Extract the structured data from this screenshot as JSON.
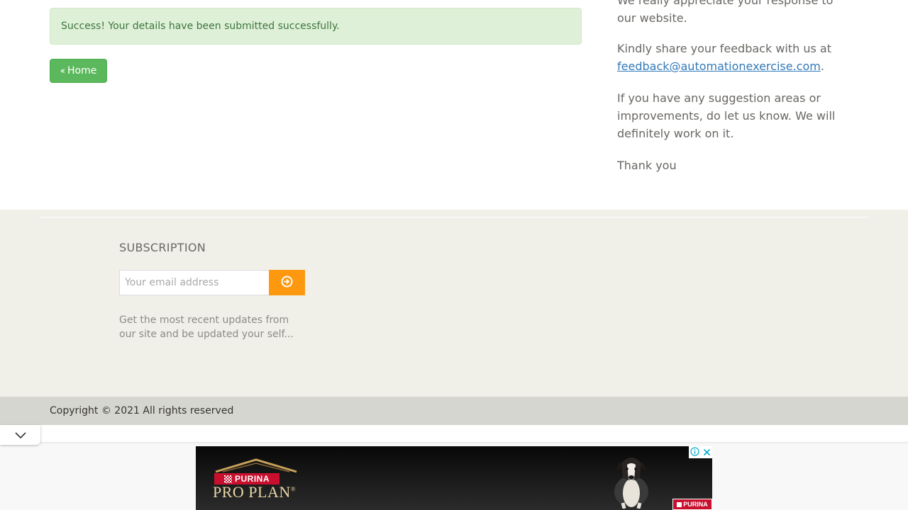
{
  "alert": {
    "message": "Success! Your details have been submitted successfully."
  },
  "home_button": {
    "label": "Home",
    "icon": "double-chevron-left-icon"
  },
  "side_text": {
    "p1": "We really appreciate your response to our website.",
    "p2_prefix": "Kindly share your feedback with us at",
    "p2_email": "feedback@automationexercise.com",
    "p2_suffix": ".",
    "p3": "If you have any suggestion areas or improvements, do let us know. We will definitely work on it.",
    "p4": "Thank you"
  },
  "subscription": {
    "title": "SUBSCRIPTION",
    "email_placeholder": "Your email address",
    "email_value": "",
    "subscribe_icon": "circle-arrow-right-icon",
    "description": "Get the most recent updates from our site and be updated your self..."
  },
  "footer": {
    "copyright": "Copyright © 2021 All rights reserved"
  },
  "ad": {
    "brand_top": "PURINA",
    "brand_main": "PRO PLAN",
    "trademark": "®",
    "badge": "PURINA",
    "icons": [
      "info-icon",
      "close-icon",
      "collapse-chevron-icon"
    ]
  },
  "colors": {
    "alert_bg": "#dff0d8",
    "alert_text": "#3c763d",
    "home_button": "#5cb85c",
    "subscribe_button": "#fe980f",
    "link": "#337ab7",
    "footer_widget_bg": "#f0f0e9",
    "footer_bottom_bg": "#d6d6d0",
    "purina_red": "#c8102e"
  }
}
